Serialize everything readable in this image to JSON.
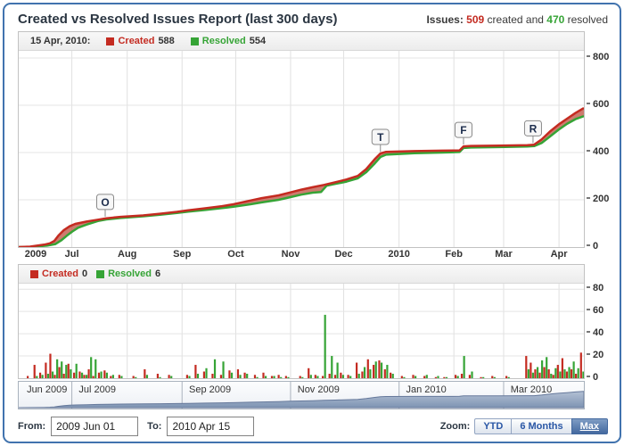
{
  "header": {
    "title": "Created vs Resolved Issues Report (last 300 days)",
    "issues_label": "Issues:",
    "created_count": "509",
    "created_suffix": "created and",
    "resolved_count": "470",
    "resolved_suffix": "resolved"
  },
  "colors": {
    "frame_accent": "#4173ae",
    "created_red": "#c42b21",
    "resolved_green": "#36a436",
    "fill_between": "rgba(186,72,56,0.72)",
    "gridline": "#e4e4e4",
    "navigator_area_top": "#b3c0d4",
    "navigator_area_bottom": "#7e94b3"
  },
  "legend_top": {
    "date": "15 Apr, 2010:",
    "created_label": "Created",
    "created_value": "588",
    "resolved_label": "Resolved",
    "resolved_value": "554"
  },
  "legend_daily": {
    "created_label": "Created",
    "created_value": "0",
    "resolved_label": "Resolved",
    "resolved_value": "6"
  },
  "footer": {
    "from_label": "From:",
    "from_value": "2009 Jun 01",
    "to_label": "To:",
    "to_value": "2010 Apr 15",
    "zoom_label": "Zoom:",
    "zoom_buttons": [
      {
        "label": "YTD",
        "active": false
      },
      {
        "label": "6 Months",
        "active": false
      },
      {
        "label": "Max",
        "active": true
      }
    ]
  },
  "chart_data": [
    {
      "type": "area",
      "description": "Cumulative created vs resolved issues, 2009 Jun 01 - 2010 Apr 15",
      "ylim": [
        0,
        830
      ],
      "y_ticks": [
        0,
        200,
        400,
        600,
        800
      ],
      "grid_x": [
        0.094,
        0.192,
        0.289,
        0.384,
        0.481,
        0.575,
        0.673,
        0.77,
        0.858,
        0.956
      ],
      "x_labels": [
        {
          "label": "2009",
          "x": 0.03
        },
        {
          "label": "Jul",
          "x": 0.094
        },
        {
          "label": "Aug",
          "x": 0.192
        },
        {
          "label": "Sep",
          "x": 0.289
        },
        {
          "label": "Oct",
          "x": 0.384
        },
        {
          "label": "Nov",
          "x": 0.481
        },
        {
          "label": "Dec",
          "x": 0.575
        },
        {
          "label": "2010",
          "x": 0.673
        },
        {
          "label": "Feb",
          "x": 0.77
        },
        {
          "label": "Mar",
          "x": 0.858
        },
        {
          "label": "Apr",
          "x": 0.956
        }
      ],
      "series": [
        {
          "name": "Created",
          "color": "#c42b21",
          "final_value": 588,
          "points": [
            [
              0,
              0
            ],
            [
              0.02,
              2
            ],
            [
              0.045,
              10
            ],
            [
              0.055,
              16
            ],
            [
              0.063,
              26
            ],
            [
              0.07,
              48
            ],
            [
              0.08,
              72
            ],
            [
              0.09,
              88
            ],
            [
              0.1,
              98
            ],
            [
              0.12,
              108
            ],
            [
              0.14,
              116
            ],
            [
              0.155,
              122
            ],
            [
              0.18,
              128
            ],
            [
              0.22,
              134
            ],
            [
              0.25,
              141
            ],
            [
              0.28,
              149
            ],
            [
              0.3,
              156
            ],
            [
              0.33,
              164
            ],
            [
              0.36,
              173
            ],
            [
              0.38,
              181
            ],
            [
              0.41,
              197
            ],
            [
              0.43,
              207
            ],
            [
              0.46,
              219
            ],
            [
              0.48,
              231
            ],
            [
              0.5,
              243
            ],
            [
              0.52,
              253
            ],
            [
              0.54,
              263
            ],
            [
              0.56,
              274
            ],
            [
              0.58,
              286
            ],
            [
              0.6,
              301
            ],
            [
              0.615,
              330
            ],
            [
              0.63,
              372
            ],
            [
              0.64,
              396
            ],
            [
              0.65,
              403
            ],
            [
              0.7,
              406
            ],
            [
              0.75,
              408
            ],
            [
              0.78,
              409
            ],
            [
              0.787,
              426
            ],
            [
              0.8,
              428
            ],
            [
              0.85,
              429
            ],
            [
              0.9,
              431
            ],
            [
              0.912,
              433
            ],
            [
              0.925,
              455
            ],
            [
              0.94,
              489
            ],
            [
              0.955,
              518
            ],
            [
              0.97,
              543
            ],
            [
              0.985,
              567
            ],
            [
              1.0,
              588
            ]
          ]
        },
        {
          "name": "Resolved",
          "color": "#36a436",
          "final_value": 554,
          "points": [
            [
              0,
              0
            ],
            [
              0.02,
              1
            ],
            [
              0.05,
              6
            ],
            [
              0.065,
              13
            ],
            [
              0.075,
              28
            ],
            [
              0.085,
              48
            ],
            [
              0.095,
              66
            ],
            [
              0.105,
              82
            ],
            [
              0.12,
              95
            ],
            [
              0.14,
              110
            ],
            [
              0.155,
              117
            ],
            [
              0.18,
              123
            ],
            [
              0.22,
              130
            ],
            [
              0.25,
              137
            ],
            [
              0.28,
              144
            ],
            [
              0.3,
              150
            ],
            [
              0.33,
              157
            ],
            [
              0.36,
              165
            ],
            [
              0.38,
              171
            ],
            [
              0.41,
              181
            ],
            [
              0.43,
              189
            ],
            [
              0.46,
              200
            ],
            [
              0.48,
              211
            ],
            [
              0.5,
              222
            ],
            [
              0.52,
              230
            ],
            [
              0.535,
              233
            ],
            [
              0.545,
              260
            ],
            [
              0.56,
              267
            ],
            [
              0.58,
              277
            ],
            [
              0.6,
              291
            ],
            [
              0.615,
              317
            ],
            [
              0.63,
              354
            ],
            [
              0.64,
              381
            ],
            [
              0.65,
              391
            ],
            [
              0.7,
              397
            ],
            [
              0.75,
              400
            ],
            [
              0.78,
              402
            ],
            [
              0.787,
              419
            ],
            [
              0.8,
              421
            ],
            [
              0.85,
              423
            ],
            [
              0.9,
              425
            ],
            [
              0.912,
              427
            ],
            [
              0.925,
              440
            ],
            [
              0.94,
              468
            ],
            [
              0.955,
              496
            ],
            [
              0.97,
              521
            ],
            [
              0.985,
              541
            ],
            [
              1.0,
              554
            ]
          ]
        }
      ],
      "flags": [
        {
          "label": "O",
          "x": 0.153
        },
        {
          "label": "T",
          "x": 0.64
        },
        {
          "label": "F",
          "x": 0.787
        },
        {
          "label": "R",
          "x": 0.91
        }
      ]
    },
    {
      "type": "bar",
      "description": "Daily created (red) and resolved (green) issue counts",
      "ylim": [
        0,
        85
      ],
      "y_ticks": [
        0,
        20,
        40,
        60,
        80
      ],
      "grid_x": [
        0.094,
        0.192,
        0.289,
        0.384,
        0.481,
        0.575,
        0.673,
        0.77,
        0.858,
        0.956
      ],
      "series_names": [
        "Created",
        "Resolved"
      ],
      "bars": [
        [
          0.018,
          2,
          0
        ],
        [
          0.03,
          12,
          2
        ],
        [
          0.04,
          5,
          3
        ],
        [
          0.05,
          14,
          4
        ],
        [
          0.058,
          22,
          6
        ],
        [
          0.066,
          3,
          17
        ],
        [
          0.074,
          10,
          15
        ],
        [
          0.082,
          4,
          12
        ],
        [
          0.09,
          13,
          8
        ],
        [
          0.1,
          5,
          13
        ],
        [
          0.11,
          6,
          5
        ],
        [
          0.118,
          3,
          3
        ],
        [
          0.126,
          8,
          19
        ],
        [
          0.134,
          2,
          17
        ],
        [
          0.144,
          5,
          6
        ],
        [
          0.154,
          7,
          5
        ],
        [
          0.165,
          2,
          3
        ],
        [
          0.18,
          3,
          2
        ],
        [
          0.205,
          2,
          1
        ],
        [
          0.225,
          8,
          3
        ],
        [
          0.248,
          4,
          1
        ],
        [
          0.268,
          3,
          2
        ],
        [
          0.3,
          3,
          2
        ],
        [
          0.315,
          12,
          4
        ],
        [
          0.33,
          6,
          9
        ],
        [
          0.345,
          4,
          17
        ],
        [
          0.36,
          3,
          15
        ],
        [
          0.375,
          7,
          5
        ],
        [
          0.39,
          8,
          3
        ],
        [
          0.402,
          5,
          4
        ],
        [
          0.42,
          3,
          1
        ],
        [
          0.435,
          5,
          2
        ],
        [
          0.45,
          2,
          2
        ],
        [
          0.462,
          3,
          1
        ],
        [
          0.475,
          2,
          1
        ],
        [
          0.5,
          2,
          1
        ],
        [
          0.515,
          9,
          3
        ],
        [
          0.527,
          3,
          2
        ],
        [
          0.54,
          2,
          57
        ],
        [
          0.552,
          4,
          20
        ],
        [
          0.562,
          3,
          14
        ],
        [
          0.572,
          5,
          3
        ],
        [
          0.585,
          3,
          2
        ],
        [
          0.6,
          14,
          4
        ],
        [
          0.61,
          6,
          10
        ],
        [
          0.62,
          17,
          8
        ],
        [
          0.63,
          12,
          15
        ],
        [
          0.64,
          16,
          14
        ],
        [
          0.65,
          8,
          12
        ],
        [
          0.66,
          5,
          4
        ],
        [
          0.68,
          2,
          1
        ],
        [
          0.7,
          3,
          2
        ],
        [
          0.72,
          2,
          3
        ],
        [
          0.74,
          1,
          2
        ],
        [
          0.755,
          1,
          1
        ],
        [
          0.775,
          3,
          2
        ],
        [
          0.786,
          4,
          20
        ],
        [
          0.8,
          3,
          6
        ],
        [
          0.82,
          1,
          1
        ],
        [
          0.84,
          2,
          1
        ],
        [
          0.865,
          2,
          1
        ],
        [
          0.9,
          20,
          8
        ],
        [
          0.908,
          14,
          5
        ],
        [
          0.916,
          8,
          10
        ],
        [
          0.924,
          5,
          16
        ],
        [
          0.932,
          10,
          19
        ],
        [
          0.94,
          8,
          4
        ],
        [
          0.948,
          3,
          9
        ],
        [
          0.956,
          12,
          6
        ],
        [
          0.964,
          18,
          8
        ],
        [
          0.972,
          6,
          10
        ],
        [
          0.98,
          8,
          15
        ],
        [
          0.988,
          4,
          9
        ],
        [
          0.997,
          23,
          6
        ]
      ]
    },
    {
      "type": "area",
      "description": "Range navigator showing cumulative created trend, full range selected",
      "area_source": "created-cumulative",
      "dividers": [
        0.094,
        0.289,
        0.481,
        0.673,
        0.858
      ],
      "labels": [
        {
          "label": "Jun 2009",
          "x": 0.008
        },
        {
          "label": "Jul 2009",
          "x": 0.1
        },
        {
          "label": "Sep 2009",
          "x": 0.295
        },
        {
          "label": "Nov 2009",
          "x": 0.487
        },
        {
          "label": "Jan 2010",
          "x": 0.679
        },
        {
          "label": "Mar 2010",
          "x": 0.864
        }
      ]
    }
  ]
}
